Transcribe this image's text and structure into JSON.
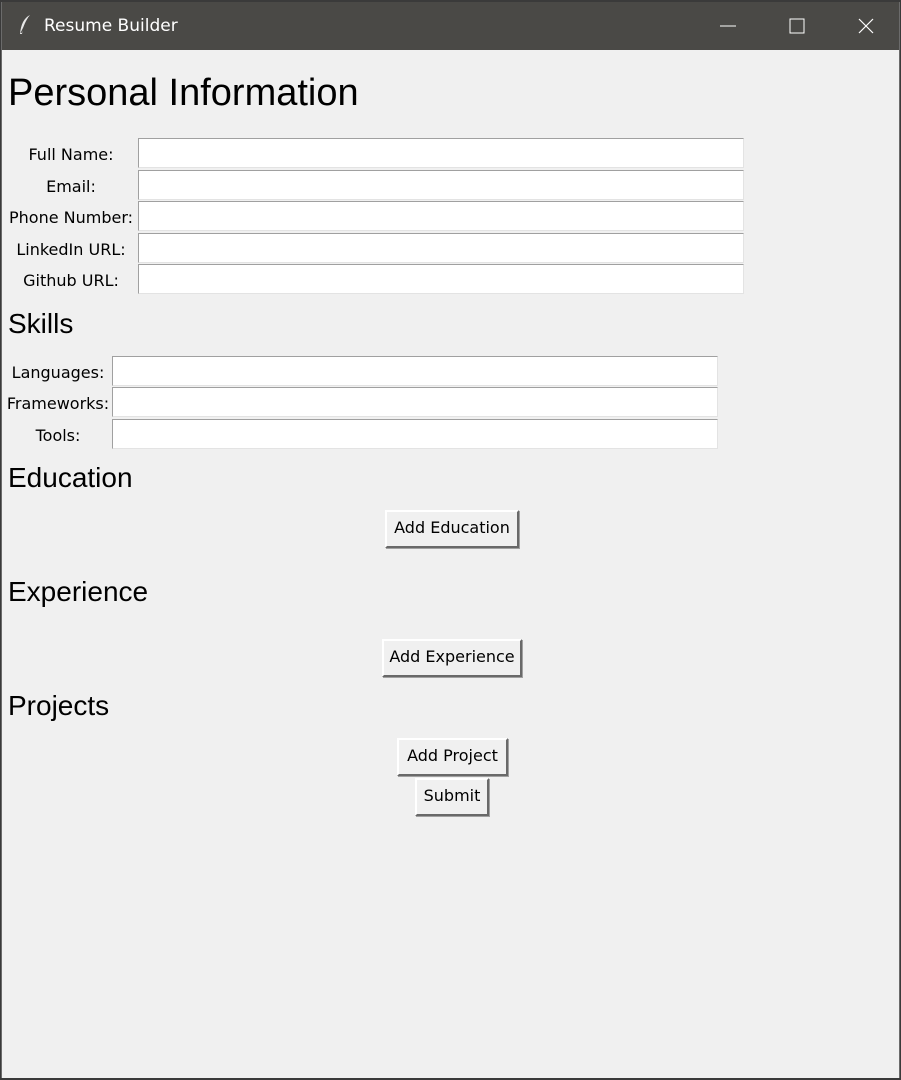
{
  "window": {
    "title": "Resume Builder",
    "icon": "feather-icon"
  },
  "sections": {
    "personal": {
      "heading": "Personal Information",
      "fields": [
        {
          "label": "Full Name:",
          "value": ""
        },
        {
          "label": "Email:",
          "value": ""
        },
        {
          "label": "Phone Number:",
          "value": ""
        },
        {
          "label": "LinkedIn URL:",
          "value": ""
        },
        {
          "label": "Github URL:",
          "value": ""
        }
      ]
    },
    "skills": {
      "heading": "Skills",
      "fields": [
        {
          "label": "Languages:",
          "value": ""
        },
        {
          "label": "Frameworks:",
          "value": ""
        },
        {
          "label": "Tools:",
          "value": ""
        }
      ]
    },
    "education": {
      "heading": "Education",
      "button": "Add Education"
    },
    "experience": {
      "heading": "Experience",
      "button": "Add Experience"
    },
    "projects": {
      "heading": "Projects",
      "button": "Add Project"
    }
  },
  "submit_label": "Submit",
  "colors": {
    "titlebar": "#4a4946",
    "window_bg": "#f0f0f0",
    "entry_bg": "#ffffff"
  }
}
